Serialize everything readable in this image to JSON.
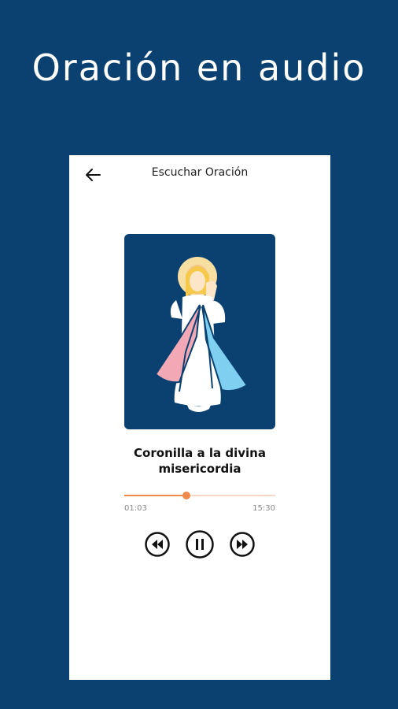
{
  "promo": {
    "headline": "Oración en audio"
  },
  "header": {
    "title": "Escuchar Oración"
  },
  "track": {
    "title": "Coronilla a la divina misericordia",
    "elapsed": "01:03",
    "total": "15:30",
    "progress": 0.41
  },
  "colors": {
    "background": "#0b4170",
    "accent": "#f08a4b",
    "card": "#ffffff"
  },
  "icons": {
    "back": "arrow-left-icon",
    "rewind": "rewind-icon",
    "pause": "pause-icon",
    "forward": "fast-forward-icon"
  }
}
